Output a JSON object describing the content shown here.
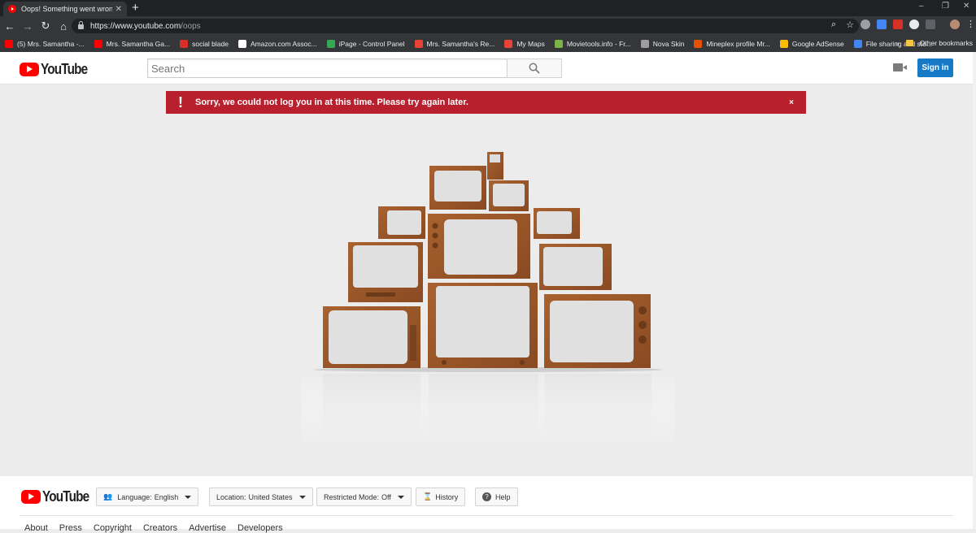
{
  "browser": {
    "tab_title": "Oops! Something went wrong. -",
    "tab_close": "✕",
    "new_tab": "+",
    "url_host": "https://www.youtube.com",
    "url_path": "/oops",
    "window_controls": [
      "–",
      "❐",
      "✕"
    ],
    "bookmarks": [
      {
        "label": "(5) Mrs. Samantha -...",
        "color": "#ff0000"
      },
      {
        "label": "Mrs. Samantha Ga...",
        "color": "#ff0000"
      },
      {
        "label": "social blade",
        "color": "#d93025"
      },
      {
        "label": "Amazon.com Assoc...",
        "color": "#ffffff"
      },
      {
        "label": "iPage - Control Panel",
        "color": "#34a853"
      },
      {
        "label": "Mrs. Samantha's Re...",
        "color": "#ea4335"
      },
      {
        "label": "My Maps",
        "color": "#ea4335"
      },
      {
        "label": "Movietools.info - Fr...",
        "color": "#7cb342"
      },
      {
        "label": "Nova Skin",
        "color": "#9e9e9e"
      },
      {
        "label": "Mineplex profile Mr...",
        "color": "#e65100"
      },
      {
        "label": "Google AdSense",
        "color": "#fbbc04"
      },
      {
        "label": "File sharing and sto...",
        "color": "#4285f4"
      }
    ],
    "more_bookmarks": "»",
    "other_bookmarks": "Other bookmarks"
  },
  "header": {
    "logo_text": "YouTube",
    "search_placeholder": "Search",
    "signin_label": "Sign in"
  },
  "alert": {
    "icon": "!",
    "message": "Sorry, we could not log you in at this time. Please try again later.",
    "close": "×",
    "color": "#b9202e"
  },
  "footer": {
    "logo_text": "YouTube",
    "language_label": "Language:",
    "language_value": "English",
    "location_label": "Location:",
    "location_value": "United States",
    "restricted_label": "Restricted Mode:",
    "restricted_value": "Off",
    "history_label": "History",
    "help_label": "Help",
    "links": [
      "About",
      "Press",
      "Copyright",
      "Creators",
      "Advertise",
      "Developers"
    ]
  }
}
